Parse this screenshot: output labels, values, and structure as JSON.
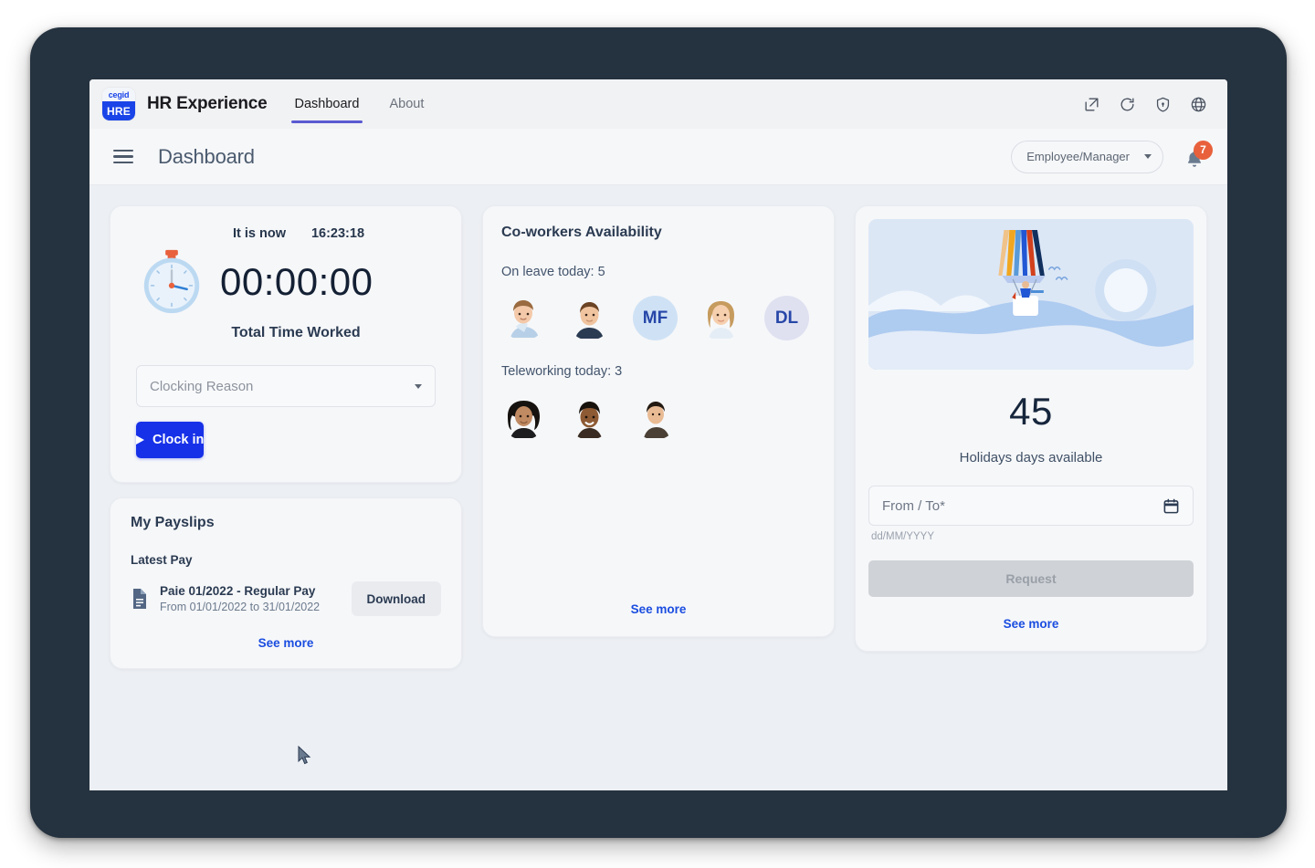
{
  "app": {
    "logo_top": "cegid",
    "logo_bottom": "HRE",
    "title": "HR Experience",
    "nav": [
      {
        "label": "Dashboard",
        "active": true
      },
      {
        "label": "About",
        "active": false
      }
    ],
    "top_icons": [
      "external-link-icon",
      "refresh-icon",
      "shield-icon",
      "globe-icon"
    ]
  },
  "header": {
    "page_title": "Dashboard",
    "role_selector": "Employee/Manager",
    "notification_count": "7"
  },
  "clock_card": {
    "it_is_now_label": "It is now",
    "current_time": "16:23:18",
    "timer": "00:00:00",
    "total_time_worked": "Total Time Worked",
    "reason_placeholder": "Clocking Reason",
    "clock_in_label": "Clock in"
  },
  "payslips_card": {
    "title": "My Payslips",
    "section_label": "Latest Pay",
    "item_name": "Paie 01/2022 - Regular Pay",
    "item_range": "From 01/01/2022 to 31/01/2022",
    "download_label": "Download",
    "see_more": "See more"
  },
  "coworkers_card": {
    "title": "Co-workers Availability",
    "on_leave_label": "On leave today: 5",
    "on_leave": [
      {
        "type": "photo",
        "id": "avatar-photo-1"
      },
      {
        "type": "photo",
        "id": "avatar-photo-2"
      },
      {
        "type": "initials",
        "initials": "MF",
        "bg": "#cfe2f5"
      },
      {
        "type": "photo",
        "id": "avatar-photo-3"
      },
      {
        "type": "initials",
        "initials": "DL",
        "bg": "#dfe1f1"
      }
    ],
    "teleworking_label": "Teleworking today: 3",
    "teleworking": [
      {
        "type": "photo",
        "id": "avatar-photo-4"
      },
      {
        "type": "photo",
        "id": "avatar-photo-5"
      },
      {
        "type": "photo",
        "id": "avatar-photo-6"
      }
    ],
    "see_more": "See more"
  },
  "holidays_card": {
    "illustration": "hot-air-balloon-illustration",
    "days_available": "45",
    "days_label": "Holidays days available",
    "date_placeholder": "From / To*",
    "date_hint": "dd/MM/YYYY",
    "request_label": "Request",
    "see_more": "See more"
  },
  "colors": {
    "primary_blue": "#1731e8",
    "link_blue": "#1a4de0",
    "badge_orange": "#e8613c",
    "tab_underline": "#5a5ad2",
    "page_bg": "#eceff3",
    "card_bg": "#f6f7f9",
    "bezel": "#25323f"
  }
}
